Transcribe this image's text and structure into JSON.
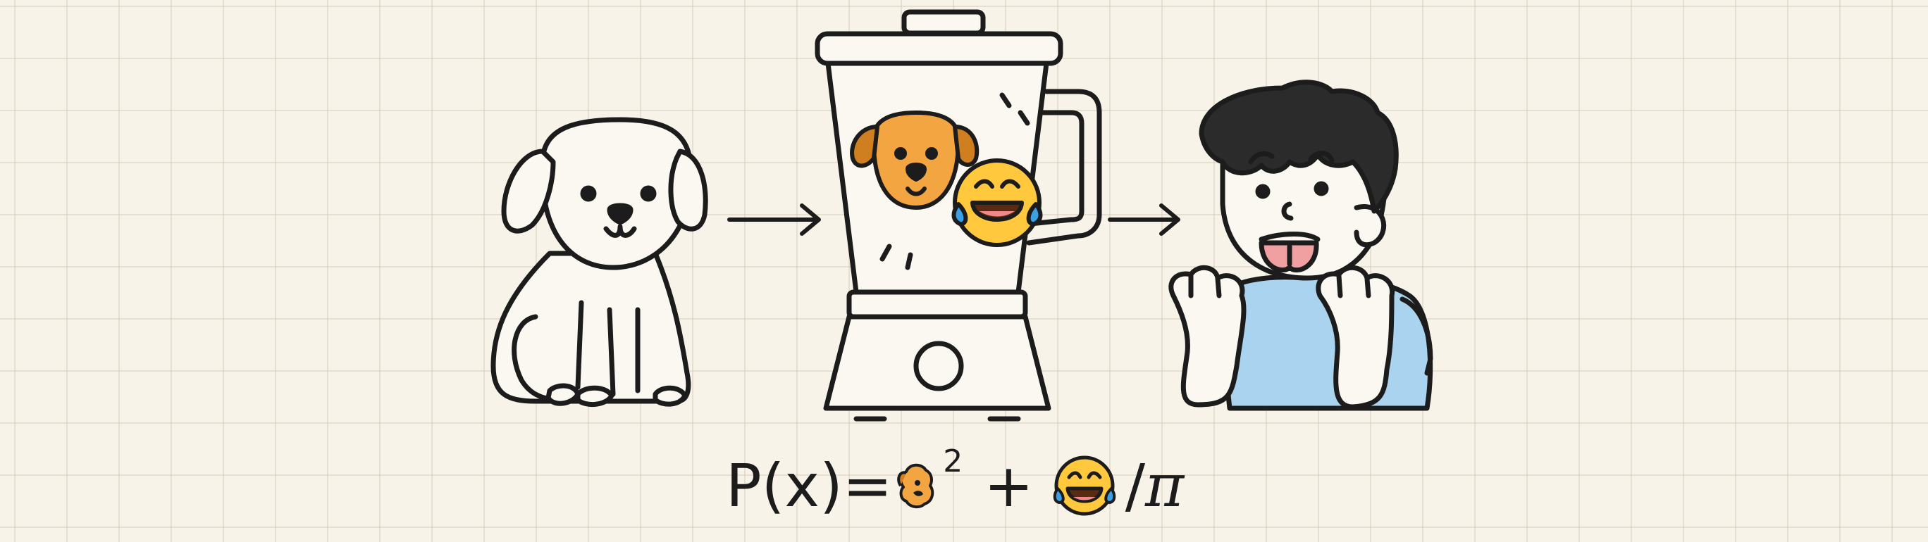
{
  "formula": {
    "prefix": "P(x)=",
    "exponent": "2",
    "plus": "+",
    "slash": "/",
    "pi": "π",
    "term_icons": [
      "dog-head-icon",
      "laughing-face-icon"
    ]
  },
  "icons": {
    "input": "dog-icon",
    "process": "blender-icon",
    "blended_items": [
      "dog-face-icon",
      "laughing-face-icon"
    ],
    "output": "surprised-boy-icon",
    "flow_arrows": [
      "arrow-right-icon",
      "arrow-right-icon"
    ]
  },
  "colors": {
    "background": "#f8f3e8",
    "grid": "#d9d0bd",
    "ink": "#1c1c1c",
    "dog_face": "#f2a541",
    "emoji_face": "#ffc83d",
    "tear": "#3aa0e8",
    "shirt": "#a9d3ee",
    "hair": "#2b2b2b",
    "tongue": "#f0a0a0"
  }
}
